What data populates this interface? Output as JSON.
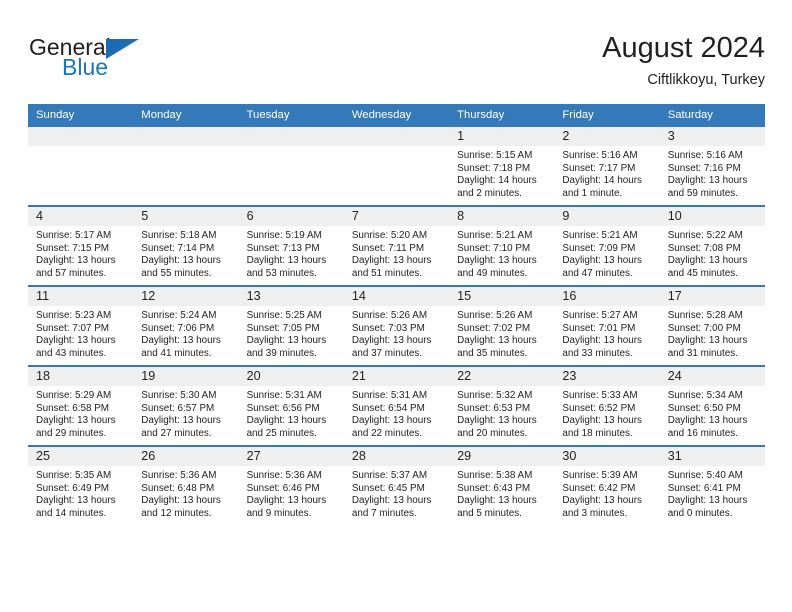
{
  "brand": {
    "name_part1": "General",
    "name_part2": "Blue",
    "accent_color": "#1b75bb",
    "triangle_color": "#1b6cb0"
  },
  "header": {
    "title": "August 2024",
    "subtitle": "Ciftlikkoyu, Turkey",
    "header_bg": "#3479b9",
    "daynum_bg": "#efefef"
  },
  "weekday_headers": [
    "Sunday",
    "Monday",
    "Tuesday",
    "Wednesday",
    "Thursday",
    "Friday",
    "Saturday"
  ],
  "labels": {
    "sunrise_prefix": "Sunrise:",
    "sunset_prefix": "Sunset:",
    "daylight_prefix": "Daylight:"
  },
  "weeks": [
    [
      {
        "day": "",
        "empty": true
      },
      {
        "day": "",
        "empty": true
      },
      {
        "day": "",
        "empty": true
      },
      {
        "day": "",
        "empty": true
      },
      {
        "day": "1",
        "sunrise": "Sunrise: 5:15 AM",
        "sunset": "Sunset: 7:18 PM",
        "daylight_l1": "Daylight: 14 hours",
        "daylight_l2": "and 2 minutes."
      },
      {
        "day": "2",
        "sunrise": "Sunrise: 5:16 AM",
        "sunset": "Sunset: 7:17 PM",
        "daylight_l1": "Daylight: 14 hours",
        "daylight_l2": "and 1 minute."
      },
      {
        "day": "3",
        "sunrise": "Sunrise: 5:16 AM",
        "sunset": "Sunset: 7:16 PM",
        "daylight_l1": "Daylight: 13 hours",
        "daylight_l2": "and 59 minutes."
      }
    ],
    [
      {
        "day": "4",
        "sunrise": "Sunrise: 5:17 AM",
        "sunset": "Sunset: 7:15 PM",
        "daylight_l1": "Daylight: 13 hours",
        "daylight_l2": "and 57 minutes."
      },
      {
        "day": "5",
        "sunrise": "Sunrise: 5:18 AM",
        "sunset": "Sunset: 7:14 PM",
        "daylight_l1": "Daylight: 13 hours",
        "daylight_l2": "and 55 minutes."
      },
      {
        "day": "6",
        "sunrise": "Sunrise: 5:19 AM",
        "sunset": "Sunset: 7:13 PM",
        "daylight_l1": "Daylight: 13 hours",
        "daylight_l2": "and 53 minutes."
      },
      {
        "day": "7",
        "sunrise": "Sunrise: 5:20 AM",
        "sunset": "Sunset: 7:11 PM",
        "daylight_l1": "Daylight: 13 hours",
        "daylight_l2": "and 51 minutes."
      },
      {
        "day": "8",
        "sunrise": "Sunrise: 5:21 AM",
        "sunset": "Sunset: 7:10 PM",
        "daylight_l1": "Daylight: 13 hours",
        "daylight_l2": "and 49 minutes."
      },
      {
        "day": "9",
        "sunrise": "Sunrise: 5:21 AM",
        "sunset": "Sunset: 7:09 PM",
        "daylight_l1": "Daylight: 13 hours",
        "daylight_l2": "and 47 minutes."
      },
      {
        "day": "10",
        "sunrise": "Sunrise: 5:22 AM",
        "sunset": "Sunset: 7:08 PM",
        "daylight_l1": "Daylight: 13 hours",
        "daylight_l2": "and 45 minutes."
      }
    ],
    [
      {
        "day": "11",
        "sunrise": "Sunrise: 5:23 AM",
        "sunset": "Sunset: 7:07 PM",
        "daylight_l1": "Daylight: 13 hours",
        "daylight_l2": "and 43 minutes."
      },
      {
        "day": "12",
        "sunrise": "Sunrise: 5:24 AM",
        "sunset": "Sunset: 7:06 PM",
        "daylight_l1": "Daylight: 13 hours",
        "daylight_l2": "and 41 minutes."
      },
      {
        "day": "13",
        "sunrise": "Sunrise: 5:25 AM",
        "sunset": "Sunset: 7:05 PM",
        "daylight_l1": "Daylight: 13 hours",
        "daylight_l2": "and 39 minutes."
      },
      {
        "day": "14",
        "sunrise": "Sunrise: 5:26 AM",
        "sunset": "Sunset: 7:03 PM",
        "daylight_l1": "Daylight: 13 hours",
        "daylight_l2": "and 37 minutes."
      },
      {
        "day": "15",
        "sunrise": "Sunrise: 5:26 AM",
        "sunset": "Sunset: 7:02 PM",
        "daylight_l1": "Daylight: 13 hours",
        "daylight_l2": "and 35 minutes."
      },
      {
        "day": "16",
        "sunrise": "Sunrise: 5:27 AM",
        "sunset": "Sunset: 7:01 PM",
        "daylight_l1": "Daylight: 13 hours",
        "daylight_l2": "and 33 minutes."
      },
      {
        "day": "17",
        "sunrise": "Sunrise: 5:28 AM",
        "sunset": "Sunset: 7:00 PM",
        "daylight_l1": "Daylight: 13 hours",
        "daylight_l2": "and 31 minutes."
      }
    ],
    [
      {
        "day": "18",
        "sunrise": "Sunrise: 5:29 AM",
        "sunset": "Sunset: 6:58 PM",
        "daylight_l1": "Daylight: 13 hours",
        "daylight_l2": "and 29 minutes."
      },
      {
        "day": "19",
        "sunrise": "Sunrise: 5:30 AM",
        "sunset": "Sunset: 6:57 PM",
        "daylight_l1": "Daylight: 13 hours",
        "daylight_l2": "and 27 minutes."
      },
      {
        "day": "20",
        "sunrise": "Sunrise: 5:31 AM",
        "sunset": "Sunset: 6:56 PM",
        "daylight_l1": "Daylight: 13 hours",
        "daylight_l2": "and 25 minutes."
      },
      {
        "day": "21",
        "sunrise": "Sunrise: 5:31 AM",
        "sunset": "Sunset: 6:54 PM",
        "daylight_l1": "Daylight: 13 hours",
        "daylight_l2": "and 22 minutes."
      },
      {
        "day": "22",
        "sunrise": "Sunrise: 5:32 AM",
        "sunset": "Sunset: 6:53 PM",
        "daylight_l1": "Daylight: 13 hours",
        "daylight_l2": "and 20 minutes."
      },
      {
        "day": "23",
        "sunrise": "Sunrise: 5:33 AM",
        "sunset": "Sunset: 6:52 PM",
        "daylight_l1": "Daylight: 13 hours",
        "daylight_l2": "and 18 minutes."
      },
      {
        "day": "24",
        "sunrise": "Sunrise: 5:34 AM",
        "sunset": "Sunset: 6:50 PM",
        "daylight_l1": "Daylight: 13 hours",
        "daylight_l2": "and 16 minutes."
      }
    ],
    [
      {
        "day": "25",
        "sunrise": "Sunrise: 5:35 AM",
        "sunset": "Sunset: 6:49 PM",
        "daylight_l1": "Daylight: 13 hours",
        "daylight_l2": "and 14 minutes."
      },
      {
        "day": "26",
        "sunrise": "Sunrise: 5:36 AM",
        "sunset": "Sunset: 6:48 PM",
        "daylight_l1": "Daylight: 13 hours",
        "daylight_l2": "and 12 minutes."
      },
      {
        "day": "27",
        "sunrise": "Sunrise: 5:36 AM",
        "sunset": "Sunset: 6:46 PM",
        "daylight_l1": "Daylight: 13 hours",
        "daylight_l2": "and 9 minutes."
      },
      {
        "day": "28",
        "sunrise": "Sunrise: 5:37 AM",
        "sunset": "Sunset: 6:45 PM",
        "daylight_l1": "Daylight: 13 hours",
        "daylight_l2": "and 7 minutes."
      },
      {
        "day": "29",
        "sunrise": "Sunrise: 5:38 AM",
        "sunset": "Sunset: 6:43 PM",
        "daylight_l1": "Daylight: 13 hours",
        "daylight_l2": "and 5 minutes."
      },
      {
        "day": "30",
        "sunrise": "Sunrise: 5:39 AM",
        "sunset": "Sunset: 6:42 PM",
        "daylight_l1": "Daylight: 13 hours",
        "daylight_l2": "and 3 minutes."
      },
      {
        "day": "31",
        "sunrise": "Sunrise: 5:40 AM",
        "sunset": "Sunset: 6:41 PM",
        "daylight_l1": "Daylight: 13 hours",
        "daylight_l2": "and 0 minutes."
      }
    ]
  ]
}
